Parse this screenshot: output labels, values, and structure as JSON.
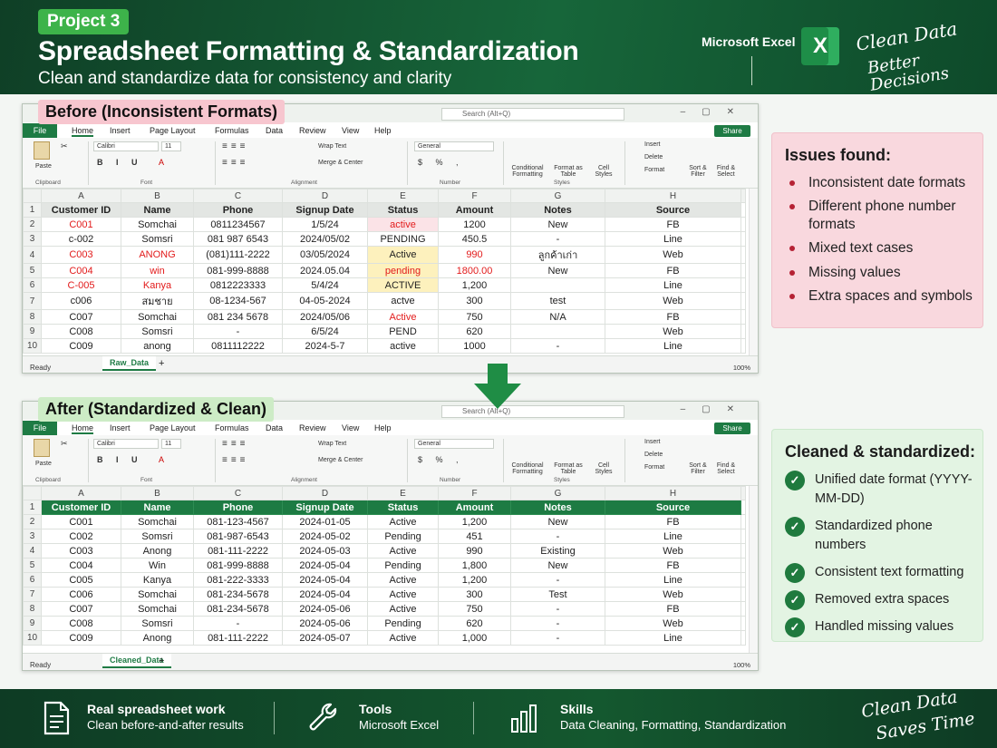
{
  "header": {
    "badge": "Project 3",
    "title": "Spreadsheet Formatting & Standardization",
    "subtitle": "Clean and standardize data for consistency and clarity",
    "brand": "Microsoft Excel",
    "excel_logo": "X",
    "tagline_1": "Clean Data",
    "tagline_2": "Better Decisions"
  },
  "before": {
    "label": "Before (Inconsistent Formats)",
    "sheet_tab": "Raw_Data"
  },
  "after": {
    "label": "After (Standardized & Clean)",
    "sheet_tab": "Cleaned_Data"
  },
  "excel_ui": {
    "search": "Search (Alt+Q)",
    "share": "Share",
    "menu": [
      "File",
      "Home",
      "Insert",
      "Page Layout",
      "Formulas",
      "Data",
      "Review",
      "View",
      "Help"
    ],
    "font": "Calibri",
    "font_size": "11",
    "number_format": "General",
    "wrap_text": "Wrap Text",
    "merge": "Merge & Center",
    "group_clipboard": "Clipboard",
    "group_font": "Font",
    "group_alignment": "Alignment",
    "group_number": "Number",
    "group_styles": "Styles",
    "paste": "Paste",
    "cond_fmt": "Conditional Formatting",
    "fmt_table": "Format as Table",
    "cell_styles": "Cell Styles",
    "insert": "Insert",
    "delete": "Delete",
    "format": "Format",
    "sort": "Sort & Filter",
    "find": "Find & Select",
    "ready": "Ready",
    "zoom": "100%",
    "col_letters": [
      "A",
      "B",
      "C",
      "D",
      "E",
      "F",
      "G",
      "H"
    ],
    "row_numbers": [
      "1",
      "2",
      "3",
      "4",
      "5",
      "6",
      "7",
      "8",
      "9",
      "10"
    ]
  },
  "columns": [
    "Customer ID",
    "Name",
    "Phone",
    "Signup Date",
    "Status",
    "Amount",
    "Notes",
    "Source"
  ],
  "raw_rows": [
    [
      "C001",
      "Somchai",
      "0811234567",
      "1/5/24",
      "active",
      "1200",
      "New",
      "FB"
    ],
    [
      "c-002",
      "Somsri",
      "081 987 6543",
      "2024/05/02",
      "PENDING",
      "450.5",
      "-",
      "Line"
    ],
    [
      "C003",
      "ANONG",
      "(081)111-2222",
      "03/05/2024",
      "Active",
      "990",
      "ลูกค้าเก่า",
      "Web"
    ],
    [
      "C004",
      "win",
      "081-999-8888",
      "2024.05.04",
      "pending",
      "1800.00",
      "New",
      "FB"
    ],
    [
      "C-005",
      "Kanya",
      "0812223333",
      "5/4/24",
      "ACTIVE",
      "1,200",
      "",
      "Line"
    ],
    [
      "c006",
      "สมชาย",
      "08-1234-567",
      "04-05-2024",
      "actve",
      "300",
      "test",
      "Web"
    ],
    [
      "C007",
      "Somchai",
      "081 234 5678",
      "2024/05/06",
      "Active",
      "750",
      "N/A",
      "FB"
    ],
    [
      "C008",
      "Somsri",
      "-",
      "6/5/24",
      "PEND",
      "620",
      "",
      "Web"
    ],
    [
      "C009",
      "anong",
      "0811112222",
      "2024-5-7",
      "active",
      "1000",
      "-",
      "Line"
    ]
  ],
  "clean_rows": [
    [
      "C001",
      "Somchai",
      "081-123-4567",
      "2024-01-05",
      "Active",
      "1,200",
      "New",
      "FB"
    ],
    [
      "C002",
      "Somsri",
      "081-987-6543",
      "2024-05-02",
      "Pending",
      "451",
      "-",
      "Line"
    ],
    [
      "C003",
      "Anong",
      "081-111-2222",
      "2024-05-03",
      "Active",
      "990",
      "Existing",
      "Web"
    ],
    [
      "C004",
      "Win",
      "081-999-8888",
      "2024-05-04",
      "Pending",
      "1,800",
      "New",
      "FB"
    ],
    [
      "C005",
      "Kanya",
      "081-222-3333",
      "2024-05-04",
      "Active",
      "1,200",
      "-",
      "Line"
    ],
    [
      "C006",
      "Somchai",
      "081-234-5678",
      "2024-05-04",
      "Active",
      "300",
      "Test",
      "Web"
    ],
    [
      "C007",
      "Somchai",
      "081-234-5678",
      "2024-05-06",
      "Active",
      "750",
      "-",
      "FB"
    ],
    [
      "C008",
      "Somsri",
      "-",
      "2024-05-06",
      "Pending",
      "620",
      "-",
      "Web"
    ],
    [
      "C009",
      "Anong",
      "081-111-2222",
      "2024-05-07",
      "Active",
      "1,000",
      "-",
      "Line"
    ]
  ],
  "issues": {
    "title": "Issues found:",
    "items": [
      "Inconsistent date formats",
      "Different phone number formats",
      "Mixed text cases",
      "Missing values",
      "Extra spaces and symbols"
    ]
  },
  "cleaned": {
    "title": "Cleaned & standardized:",
    "items": [
      "Unified date format (YYYY-MM-DD)",
      "Standardized phone numbers",
      "Consistent text formatting",
      "Removed extra spaces",
      "Handled missing values"
    ]
  },
  "footer": {
    "col1_title": "Real spreadsheet work",
    "col1_text": "Clean before-and-after results",
    "col2_title": "Tools",
    "col2_text": "Microsoft Excel",
    "col3_title": "Skills",
    "col3_text": "Data Cleaning, Formatting, Standardization",
    "tagline_1": "Clean Data",
    "tagline_2": "Saves Time"
  },
  "colors": {
    "green_dark": "#0f3f26",
    "excel_green": "#1d7b43",
    "badge": "#3db34a",
    "red_text": "#e21b1b",
    "pink_highlight": "#fbe3e7",
    "yellow_highlight": "#fdf1bd",
    "issues_bg": "#f9d8de",
    "cleaned_bg": "#e3f4e3"
  },
  "icons": {
    "excel": "excel-logo-icon",
    "arrow": "down-arrow-icon",
    "check": "check-circle-icon",
    "doc": "document-icon",
    "wrench": "wrench-icon",
    "bars": "bar-chart-icon"
  }
}
